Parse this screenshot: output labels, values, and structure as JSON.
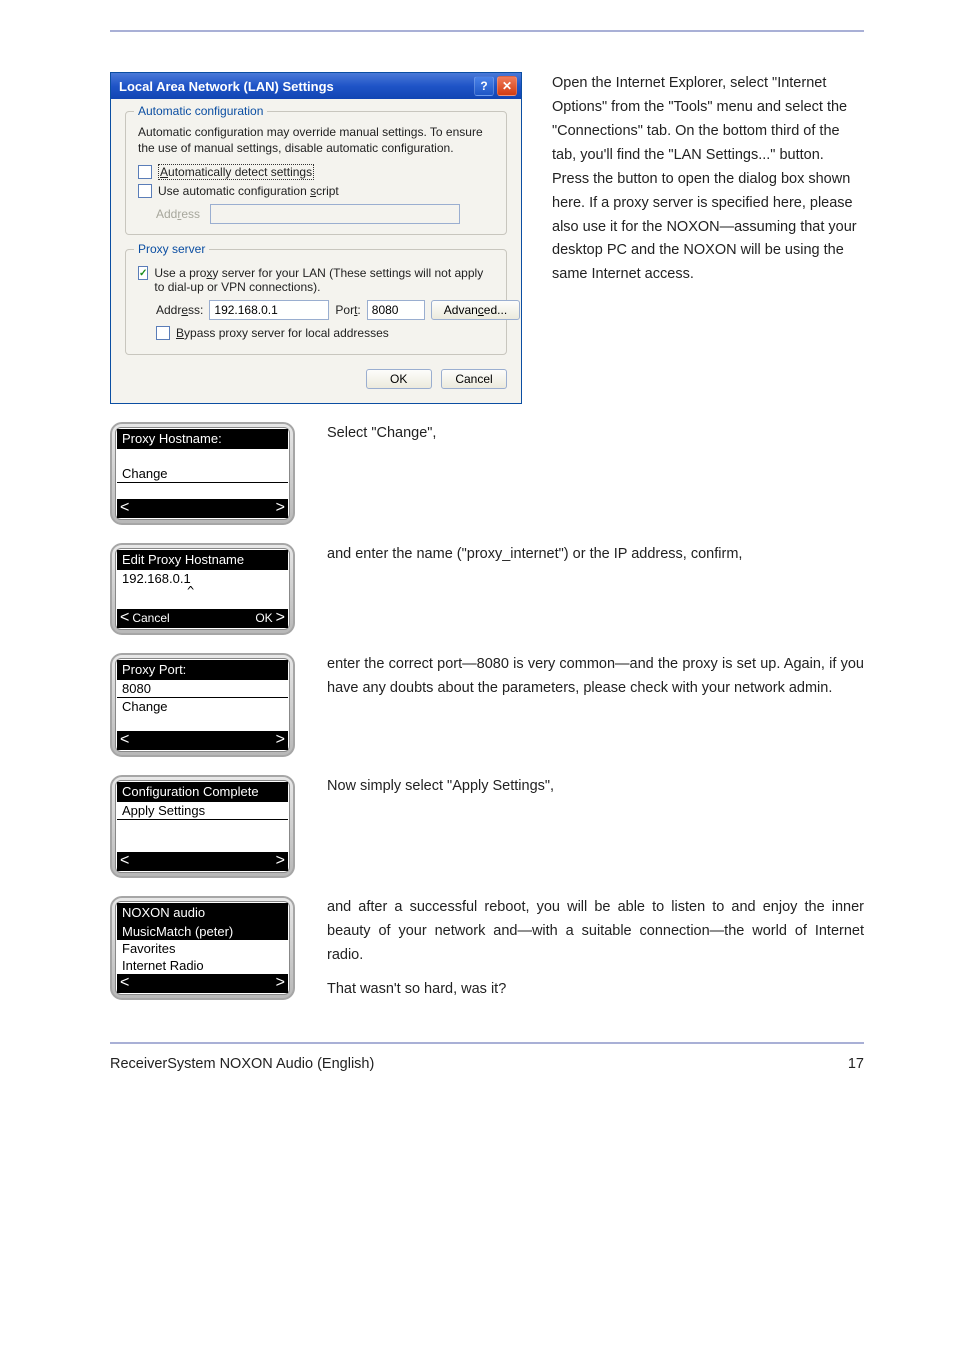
{
  "dialog": {
    "title": "Local Area Network (LAN) Settings",
    "help_icon": "?",
    "close_icon": "✕",
    "autoconf": {
      "legend": "Automatic configuration",
      "description": "Automatic configuration may override manual settings.  To ensure the use of manual settings, disable automatic configuration.",
      "detect_label": "Automatically detect settings",
      "script_label": "Use automatic configuration script",
      "address_label": "Address"
    },
    "proxy": {
      "legend": "Proxy server",
      "use_label": "Use a proxy server for your LAN (These settings will not apply to dial-up or VPN connections).",
      "address_label": "Address:",
      "address_value": "192.168.0.1",
      "port_label": "Port:",
      "port_value": "8080",
      "advanced_label": "Advanced...",
      "bypass_label": "Bypass proxy server for local addresses"
    },
    "ok": "OK",
    "cancel": "Cancel"
  },
  "para1": "Open the Internet Explorer, select \"Internet Options\" from the \"Tools\" menu and select the \"Connections\" tab. On the bottom third of the tab, you'll find the \"LAN Settings...\" button. Press the button to open the dialog box shown here. If a proxy server is specified here, please also use it for the NOXON—assuming that your desktop PC and the NOXON will be using the same Internet access.",
  "para2": "Select \"Change\",",
  "para3": "and enter the name (\"proxy_internet\") or the IP address, confirm,",
  "para4": "enter the correct port—8080 is very common—and the proxy is set up. Again, if you have any doubts about the parameters, please check with your network admin.",
  "para5": "Now simply select \"Apply Settings\",",
  "para6": "and after a successful reboot, you will be able to listen to and enjoy the inner beauty of your network and—with a suitable connection—the world of Internet radio.",
  "para7": "That wasn't so hard, was it?",
  "devices": {
    "d1": {
      "title": "Proxy Hostname:",
      "line1": "Change"
    },
    "d2": {
      "title": "Edit Proxy Hostname",
      "line1": "192.168.0.1",
      "caret": "^",
      "left": "Cancel",
      "right": "OK"
    },
    "d3": {
      "title": "Proxy Port:",
      "line1": "8080",
      "line2": "Change"
    },
    "d4": {
      "title": "Configuration Complete",
      "line1": "Apply Settings"
    },
    "d5": {
      "title": "NOXON audio",
      "sel": "MusicMatch (peter)",
      "line2": "Favorites",
      "line3": "Internet Radio"
    }
  },
  "arrows": {
    "left": "<",
    "right": ">"
  },
  "footer": {
    "left": "ReceiverSystem NOXON Audio (English)",
    "right": "17"
  }
}
